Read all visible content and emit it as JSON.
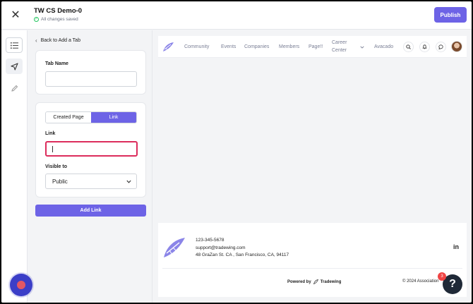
{
  "header": {
    "site_title": "TW CS Demo-0",
    "save_status": "All changes saved",
    "publish_label": "Publish"
  },
  "rail": {
    "items": [
      "list-icon",
      "navigation-icon",
      "pencil-icon"
    ],
    "active": "navigation-icon"
  },
  "panel": {
    "back_label": "Back to Add a Tab",
    "tab_name_label": "Tab Name",
    "tab_name_value": "",
    "tab_type_options": [
      "Created Page",
      "Link"
    ],
    "tab_type_selected": "Link",
    "link_label": "Link",
    "link_value": "",
    "visible_to_label": "Visible to",
    "visible_to_value": "Public",
    "add_link_label": "Add Link"
  },
  "preview": {
    "nav": {
      "items": [
        "Community",
        "Events",
        "Companies",
        "Members",
        "Page!!",
        "Career",
        "Center",
        "Avacado"
      ]
    },
    "footer": {
      "phone": "123-345-5678",
      "email": "support@tradewing.com",
      "address": "48 GraZan St. CA , San Francisco, CA, 94117",
      "social": "in",
      "powered_by": "Powered by",
      "powered_brand": "Tradewing",
      "copyright": "© 2024 Association"
    }
  },
  "widgets": {
    "help_symbol": "?",
    "help_badge_count": "3"
  },
  "colors": {
    "accent": "#6d63e6",
    "focus_border": "#dc2c5c",
    "brand_leaf": "#8b85e8"
  }
}
